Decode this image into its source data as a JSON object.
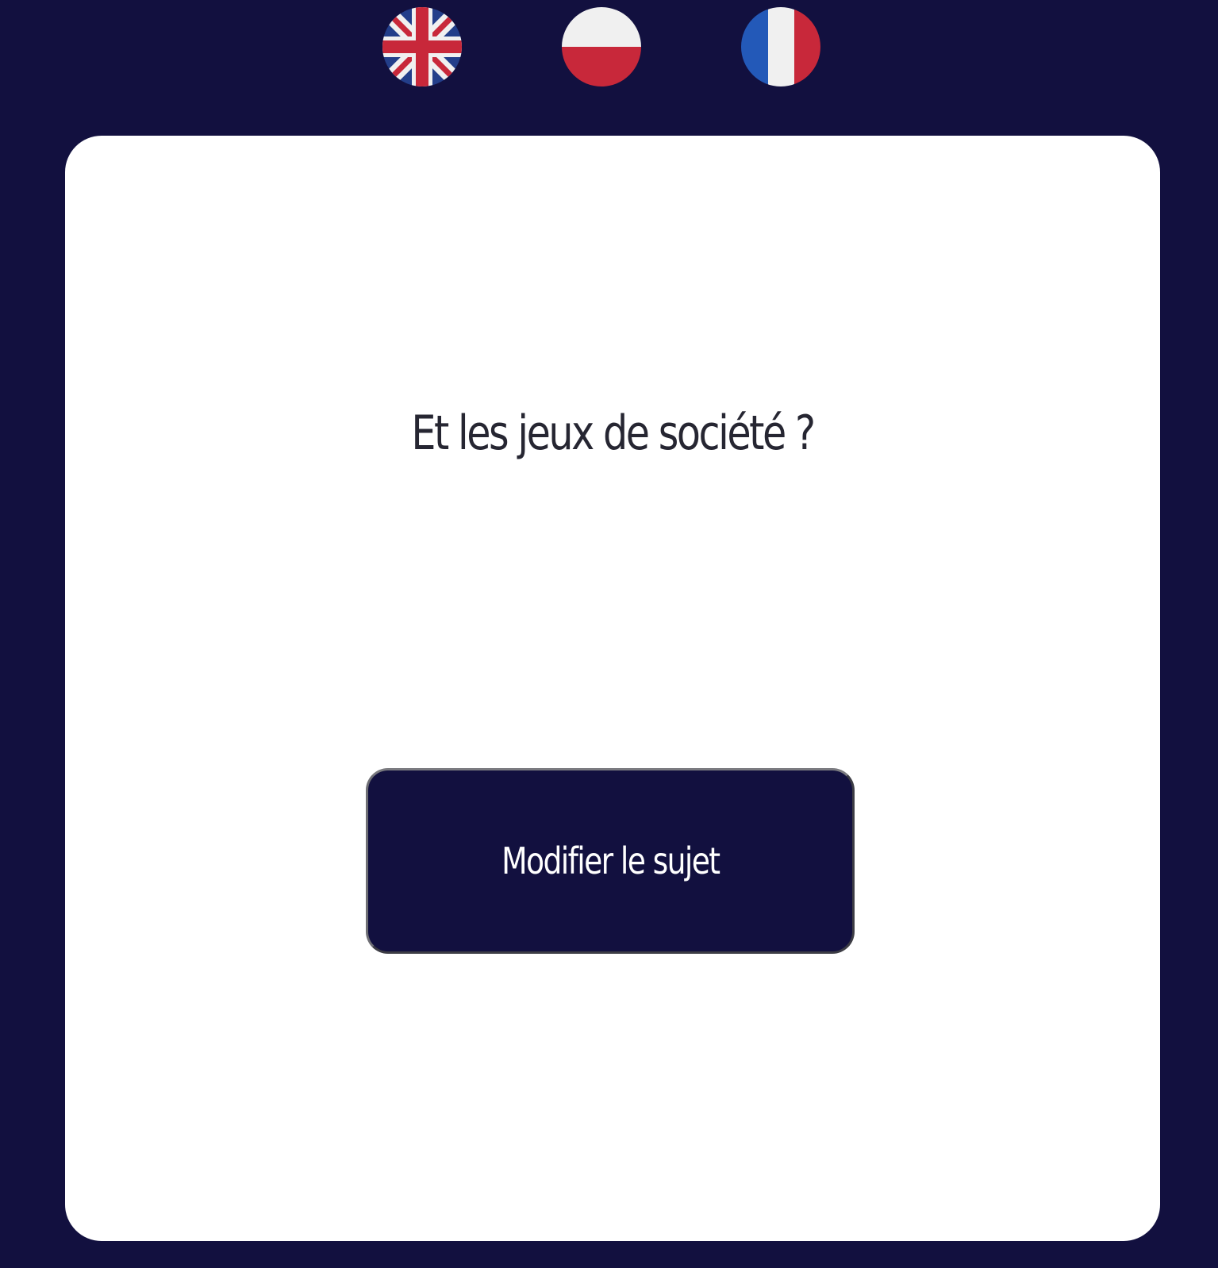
{
  "theme": {
    "background": "#12103f",
    "card_background": "#ffffff",
    "button_background": "#12103f",
    "flag_red": "#c8283a",
    "flag_blue": "#2359b8",
    "flag_white": "#f0f0f0",
    "flag_navy": "#233e8a"
  },
  "language_bar": {
    "flags": [
      {
        "language": "English",
        "icon": "uk-flag-icon"
      },
      {
        "language": "Polish",
        "icon": "poland-flag-icon"
      },
      {
        "language": "French",
        "icon": "france-flag-icon"
      }
    ]
  },
  "card": {
    "question": "Et les jeux de société ?",
    "button_label": "Modifier le sujet"
  }
}
